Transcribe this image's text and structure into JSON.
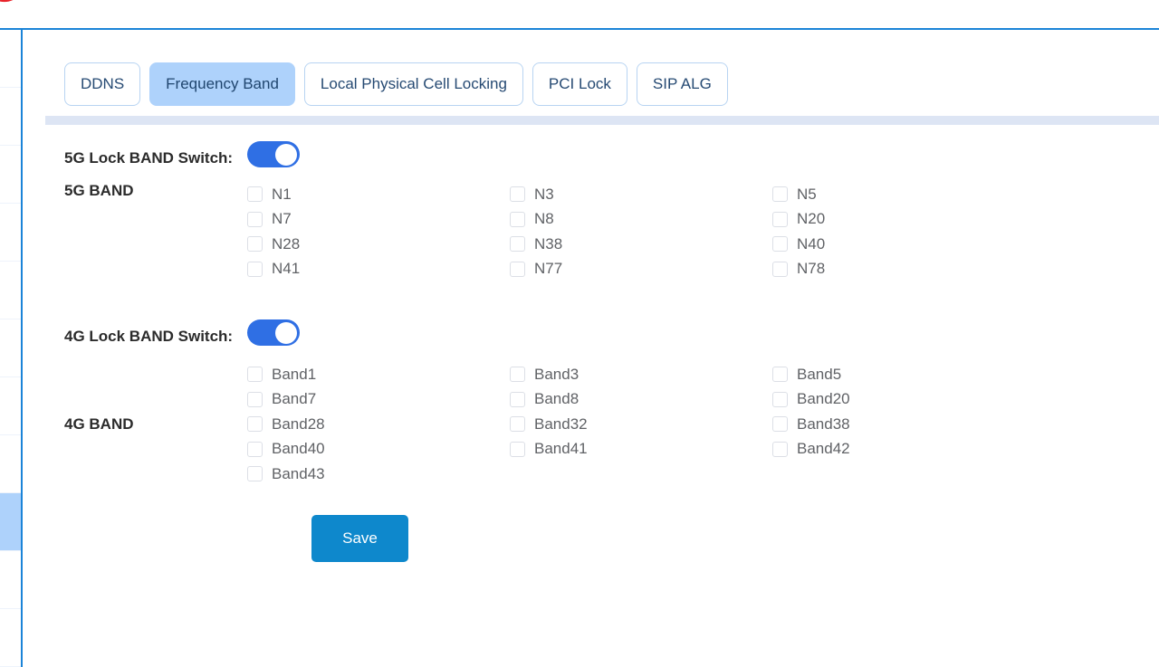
{
  "branding": {
    "logo_icon": "red-swoosh-logo-icon"
  },
  "sidebar": {
    "rows": [
      {
        "active": false
      },
      {
        "active": false
      },
      {
        "active": false
      },
      {
        "active": false
      },
      {
        "active": false
      },
      {
        "active": false
      },
      {
        "active": false
      },
      {
        "active": false
      },
      {
        "active": true
      },
      {
        "active": false
      },
      {
        "active": false
      }
    ]
  },
  "tabs": [
    {
      "label": "DDNS",
      "active": false
    },
    {
      "label": "Frequency Band",
      "active": true
    },
    {
      "label": "Local Physical Cell Locking",
      "active": false
    },
    {
      "label": "PCI Lock",
      "active": false
    },
    {
      "label": "SIP ALG",
      "active": false
    }
  ],
  "form": {
    "lock5g": {
      "label": "5G Lock BAND Switch:",
      "switch_state": "on"
    },
    "band5g": {
      "label": "5G BAND",
      "columns": [
        [
          {
            "label": "N1",
            "checked": false
          },
          {
            "label": "N7",
            "checked": false
          },
          {
            "label": "N28",
            "checked": false
          },
          {
            "label": "N41",
            "checked": false
          }
        ],
        [
          {
            "label": "N3",
            "checked": false
          },
          {
            "label": "N8",
            "checked": false
          },
          {
            "label": "N38",
            "checked": false
          },
          {
            "label": "N77",
            "checked": false
          }
        ],
        [
          {
            "label": "N5",
            "checked": false
          },
          {
            "label": "N20",
            "checked": false
          },
          {
            "label": "N40",
            "checked": false
          },
          {
            "label": "N78",
            "checked": false
          }
        ]
      ]
    },
    "lock4g": {
      "label": "4G Lock BAND Switch:",
      "switch_state": "on"
    },
    "band4g": {
      "label": "4G BAND",
      "columns": [
        [
          {
            "label": "Band1",
            "checked": false
          },
          {
            "label": "Band7",
            "checked": false
          },
          {
            "label": "Band28",
            "checked": false
          },
          {
            "label": "Band40",
            "checked": false
          },
          {
            "label": "Band43",
            "checked": false
          }
        ],
        [
          {
            "label": "Band3",
            "checked": false
          },
          {
            "label": "Band8",
            "checked": false
          },
          {
            "label": "Band32",
            "checked": false
          },
          {
            "label": "Band41",
            "checked": false
          }
        ],
        [
          {
            "label": "Band5",
            "checked": false
          },
          {
            "label": "Band20",
            "checked": false
          },
          {
            "label": "Band38",
            "checked": false
          },
          {
            "label": "Band42",
            "checked": false
          }
        ]
      ]
    },
    "save_label": "Save"
  },
  "colors": {
    "accent_blue": "#1b84d8",
    "tab_active_bg": "#aed2fb",
    "switch_on": "#2f6fe4",
    "save_bg": "#0e88cc",
    "divider": "#dde5f4",
    "logo_red": "#e8232a"
  }
}
